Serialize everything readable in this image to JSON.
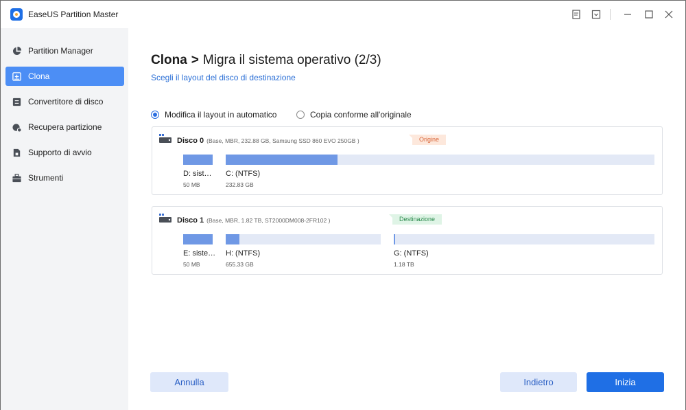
{
  "app": {
    "title": "EaseUS Partition Master"
  },
  "titlebar_icons": [
    "notes-icon",
    "dropdown-icon",
    "minimize-icon",
    "maximize-icon",
    "close-icon"
  ],
  "sidebar": {
    "items": [
      {
        "label": "Partition Manager",
        "icon": "pie-chart-icon",
        "active": false
      },
      {
        "label": "Clona",
        "icon": "clone-icon",
        "active": true
      },
      {
        "label": "Convertitore di disco",
        "icon": "disk-convert-icon",
        "active": false
      },
      {
        "label": "Recupera partizione",
        "icon": "recover-icon",
        "active": false
      },
      {
        "label": "Supporto di avvio",
        "icon": "boot-media-icon",
        "active": false
      },
      {
        "label": "Strumenti",
        "icon": "toolbox-icon",
        "active": false
      }
    ]
  },
  "main": {
    "crumb": "Clona",
    "arrow": ">",
    "title": "Migra il sistema operativo (2/3)",
    "subtitle": "Scegli il layout del disco di destinazione",
    "options": [
      {
        "label": "Modifica il layout in automatico",
        "checked": true
      },
      {
        "label": "Copia conforme all'originale",
        "checked": false
      }
    ],
    "disks": [
      {
        "name": "Disco 0",
        "info": "(Base, MBR, 232.88 GB, Samsung SSD 860 EVO 250GB )",
        "tag": "Origine",
        "partitions": [
          {
            "name": "D: sist…",
            "size": "50 MB",
            "used_fraction": 1.0
          },
          {
            "name": "C: (NTFS)",
            "size": "232.83 GB",
            "used_fraction": 0.26
          }
        ]
      },
      {
        "name": "Disco 1",
        "info": "(Base, MBR, 1.82 TB, ST2000DM008-2FR102 )",
        "tag": "Destinazione",
        "partitions": [
          {
            "name": "E: siste…",
            "size": "50 MB",
            "used_fraction": 1.0
          },
          {
            "name": "H: (NTFS)",
            "size": "655.33 GB",
            "used_fraction": 0.09
          },
          {
            "name": "G: (NTFS)",
            "size": "1.18 TB",
            "used_fraction": 0.003
          }
        ]
      }
    ]
  },
  "buttons": {
    "cancel": "Annulla",
    "back": "Indietro",
    "start": "Inizia"
  },
  "colors": {
    "accent": "#1f6fe5",
    "sidebar_active": "#4c8ef5",
    "partition_fill": "#6f98e5",
    "partition_bg": "#e3e9f6",
    "tag_origin": "#fde8dc",
    "tag_destination": "#dff4e6"
  }
}
